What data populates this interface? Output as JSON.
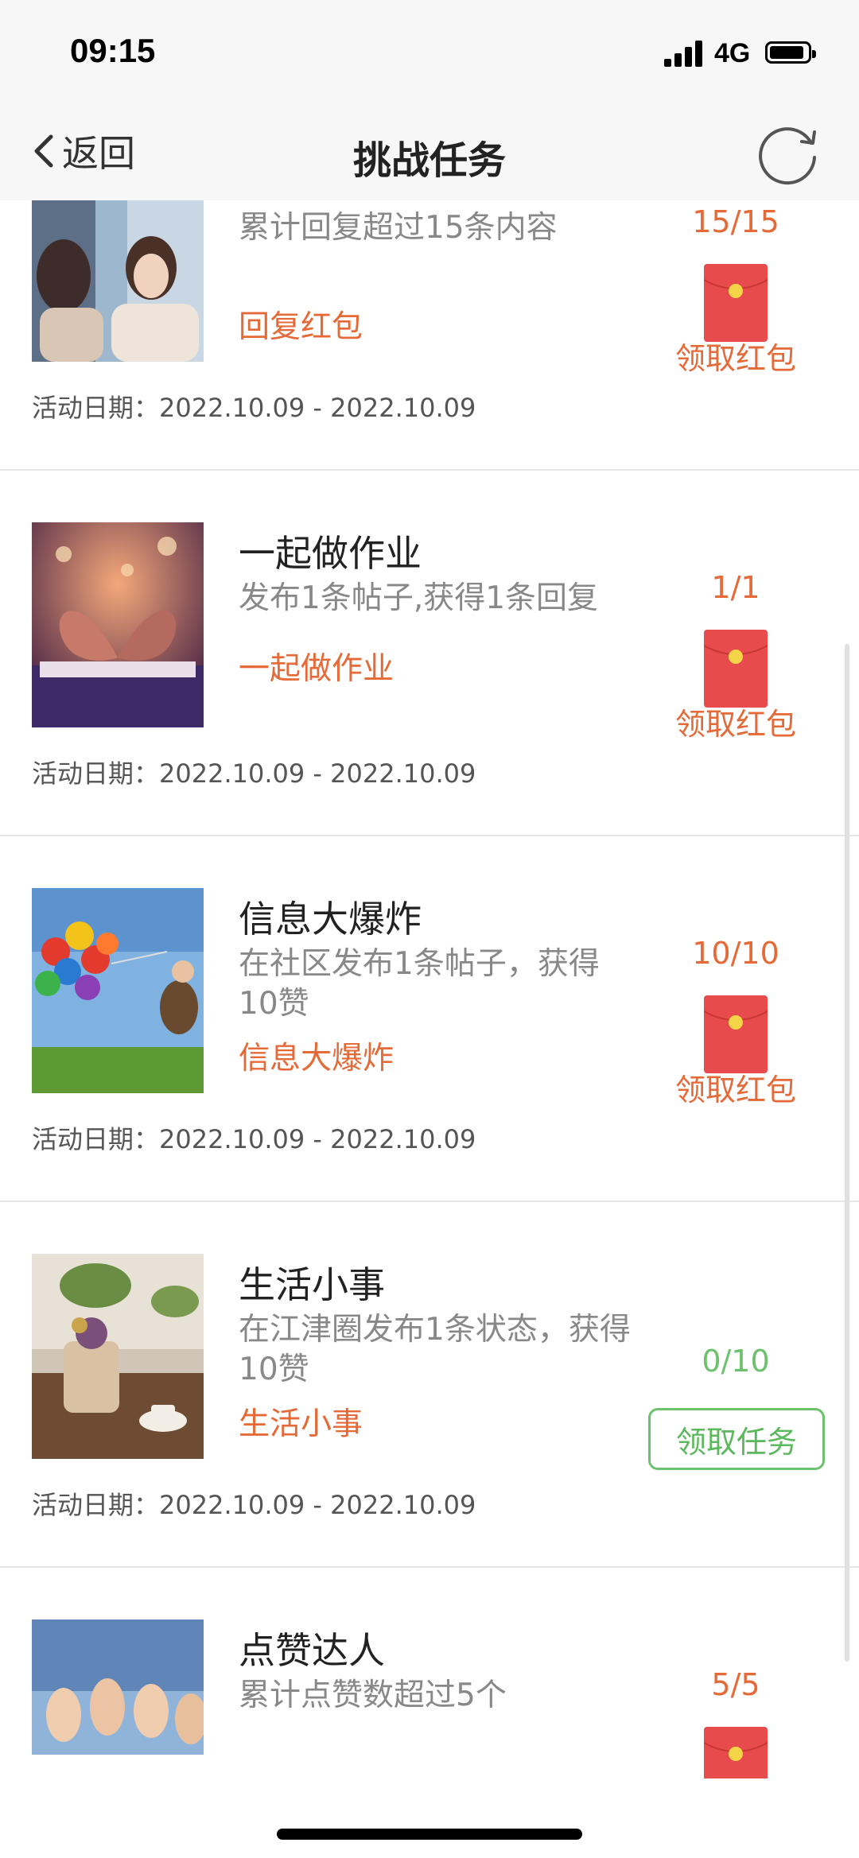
{
  "status_bar": {
    "time": "09:15",
    "network": "4G"
  },
  "nav": {
    "back_label": "返回",
    "title": "挑战任务"
  },
  "common": {
    "date_label": "活动日期："
  },
  "tasks": [
    {
      "title": "",
      "description": "累计回复超过15条内容",
      "tag": "回复红包",
      "date": "2022.10.09 - 2022.10.09",
      "progress": "15/15",
      "action": "领取红包",
      "state": "reward"
    },
    {
      "title": "一起做作业",
      "description": "发布1条帖子,获得1条回复",
      "tag": "一起做作业",
      "date": "2022.10.09 - 2022.10.09",
      "progress": "1/1",
      "action": "领取红包",
      "state": "reward"
    },
    {
      "title": "信息大爆炸",
      "description": "在社区发布1条帖子，获得10赞",
      "tag": "信息大爆炸",
      "date": "2022.10.09 - 2022.10.09",
      "progress": "10/10",
      "action": "领取红包",
      "state": "reward"
    },
    {
      "title": "生活小事",
      "description": "在江津圈发布1条状态，获得10赞",
      "tag": "生活小事",
      "date": "2022.10.09 - 2022.10.09",
      "progress": "0/10",
      "action": "领取任务",
      "state": "task"
    },
    {
      "title": "点赞达人",
      "description": "累计点赞数超过5个",
      "tag": "",
      "date": "",
      "progress": "5/5",
      "action": "",
      "state": "reward"
    }
  ],
  "colors": {
    "accent": "#e56a37",
    "success": "#6cc16c",
    "envelope": "#e84b4b",
    "seal": "#f5d547"
  }
}
